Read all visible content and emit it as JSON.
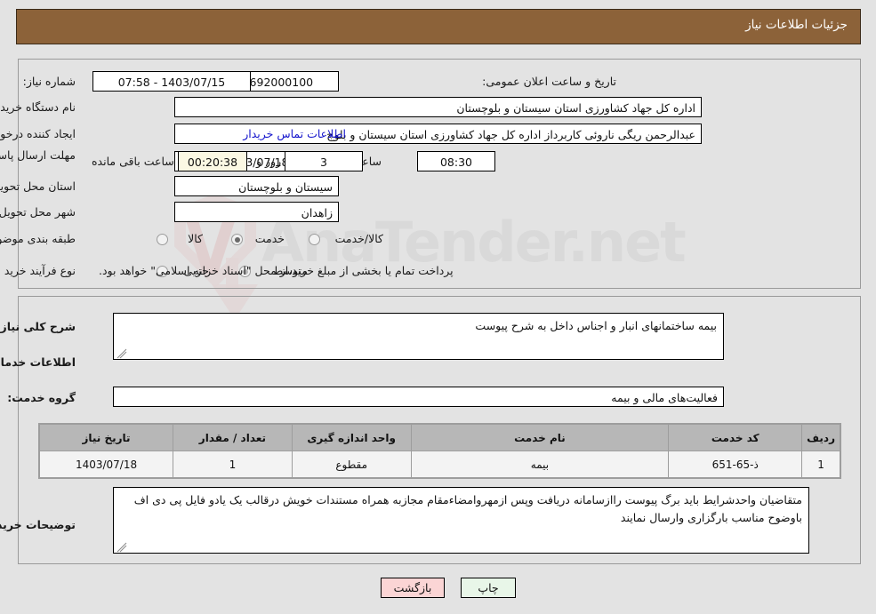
{
  "header": {
    "title": "جزئیات اطلاعات نیاز"
  },
  "watermark": {
    "brand": "AnaTender.net",
    "letter": "V"
  },
  "top_form": {
    "need_number": {
      "label": "شماره نیاز:",
      "value": "1103003692000100"
    },
    "buyer_org": {
      "label": "نام دستگاه خریدار:",
      "value": "اداره کل جهاد کشاورزی استان سیستان و بلوچستان"
    },
    "request_creator": {
      "label": "ایجاد کننده درخواست:",
      "value": "عبدالرحمن ریگی ناروئی کاربرداز اداره کل جهاد کشاورزی استان سیستان و بلوچ",
      "contact_link": "اطلاعات تماس خریدار"
    },
    "public_announce": {
      "label": "تاریخ و ساعت اعلان عمومی:",
      "value": "1403/07/15 - 07:58"
    },
    "deadline": {
      "label": "مهلت ارسال پاسخ: تا تاریخ:",
      "date": "1403/07/18",
      "time_label": "ساعت",
      "time": "08:30",
      "days": "3",
      "days_label": "روز و",
      "countdown": "00:20:38",
      "countdown_label": "ساعت باقی مانده"
    },
    "delivery_province": {
      "label": "استان محل تحویل:",
      "value": "سیستان و بلوچستان"
    },
    "delivery_city": {
      "label": "شهر محل تحویل:",
      "value": "زاهدان"
    },
    "subject_category": {
      "label": "طبقه بندی موضوعی:",
      "options": [
        "کالا",
        "خدمت",
        "کالا/خدمت"
      ],
      "selected": "خدمت"
    },
    "purchase_process": {
      "label": "نوع فرآیند خرید :",
      "options": [
        "جزیی",
        "متوسط"
      ],
      "selected": "متوسط",
      "note": "پرداخت تمام یا بخشی از مبلغ خرید،از محل \"اسناد خزانه اسلامی\" خواهد بود."
    }
  },
  "mid_form": {
    "general_description": {
      "label": "شرح کلی نیاز:",
      "value": "بیمه ساختمانهای انبار و اجناس داخل به شرح پیوست"
    },
    "services_heading": "اطلاعات خدمات مورد نیاز",
    "service_group": {
      "label": "گروه خدمت:",
      "value": "فعالیت‌های مالی و بیمه"
    },
    "table": {
      "columns": [
        "ردیف",
        "کد خدمت",
        "نام خدمت",
        "واحد اندازه گیری",
        "تعداد / مقدار",
        "تاریخ نیاز"
      ],
      "rows": [
        {
          "row_no": "1",
          "service_code": "ذ-65-651",
          "service_name": "بیمه",
          "unit": "مقطوع",
          "quantity": "1",
          "need_date": "1403/07/18"
        }
      ]
    },
    "buyer_notes": {
      "label": "توضیحات خریدار:",
      "value": "متقاضیان واحدشرایط باید برگ پیوست راازسامانه دریافت وپس ازمهروامضاءمقام مجازبه همراه مستندات  خویش درقالب یک یادو فایل پی دی اف باوضوح مناسب بارگزاری وارسال نمایند"
    }
  },
  "footer": {
    "print_button": "چاپ",
    "back_button": "بازگشت"
  },
  "colors": {
    "header_bg": "#8c6239",
    "print_bg": "#e8f6e8",
    "back_bg": "#fbd5d5",
    "countdown_bg": "#fbf8e3",
    "link": "#1515cc"
  }
}
